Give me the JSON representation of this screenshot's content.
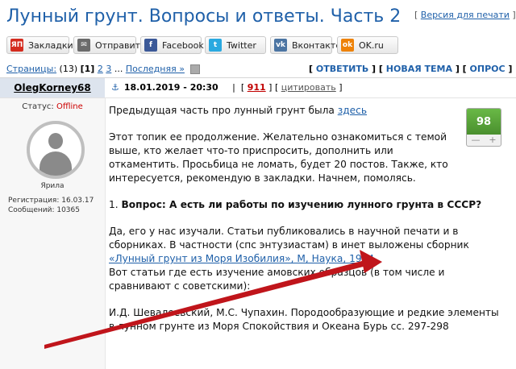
{
  "topic": {
    "title": "Лунный грунт. Вопросы и ответы. Часть 2",
    "print_prefix": "[ ",
    "print_label": "Версия для печати",
    "print_suffix": " ]"
  },
  "share": [
    {
      "icon": "ЯП",
      "label": "Закладки",
      "color": "#d42b1e"
    },
    {
      "icon": "✉",
      "label": "Отправить",
      "color": "#6b6b6b"
    },
    {
      "icon": "f",
      "label": "Facebook",
      "color": "#3b5998"
    },
    {
      "icon": "t",
      "label": "Twitter",
      "color": "#2aa9e0"
    },
    {
      "icon": "vk",
      "label": "Вконтакте",
      "color": "#4c75a3"
    },
    {
      "icon": "ok",
      "label": "OK.ru",
      "color": "#ee8208"
    }
  ],
  "pagination": {
    "label": "Страницы:",
    "count": " (13) ",
    "current": "[1]",
    "page2": "2",
    "page3": "3",
    "dots": " ... ",
    "last": "Последняя »"
  },
  "actions": {
    "reply": "ОТВЕТИТЬ",
    "new_topic": "НОВАЯ ТЕМА",
    "poll": "ОПРОС"
  },
  "post": {
    "author": "OlegKorney68",
    "anchor": "⚓",
    "date": "18.01.2019 - 20:30",
    "number": "911",
    "cite": "цитировать",
    "status_label": "Статус: ",
    "status_value": "Offline",
    "rank": "Ярила",
    "reg_label": "Регистрация: ",
    "reg_value": "16.03.17",
    "msgs_label": "Сообщений: ",
    "msgs_value": "10365",
    "rating": "98",
    "rating_plus": "+",
    "rating_minus": "—",
    "p1_text": "Предыдущая часть про лунный грунт была ",
    "p1_link": "здесь",
    "p2": "Этот топик ее продолжение. Желательно ознакомиться с темой выше, кто желает что-то приспросить, дополнить или откаментить. Просьбица не ломать, будет 20 постов. Также, кто интересуется, рекомендую в закладки. Начнем, помолясь.",
    "q_num": "1. ",
    "q_text": "Вопрос: А есть ли работы по изучению лунного грунта в СССР?",
    "p4_text": "Да, его у нас изучали. Статьи публиковались в научной печати и в сборниках. В частности (спс энтузиастам) в инет выложены сборник ",
    "p4_link": "«Лунный грунт из Моря Изобилия», М, Наука, 1974.",
    "p5": "Вот статьи где есть изучение амовских образцов (в том числе и сравнивают с советскими):",
    "p6": "И.Д. Шевалеевский, М.С. Чупахин. Породообразующие и редкие элементы в лунном грунте из Моря Спокойствия и Океана Бурь сс. 297-298"
  },
  "colors": {
    "link": "#1f60a9",
    "arrow": "#c0151b",
    "rating": "#5aa63a",
    "offline": "#cc0000"
  }
}
